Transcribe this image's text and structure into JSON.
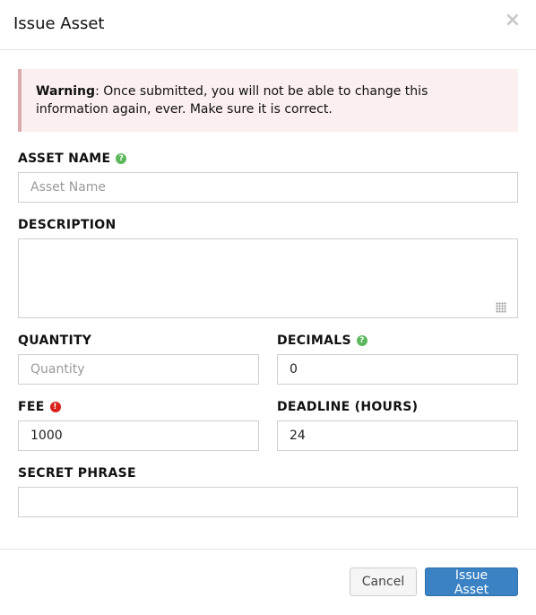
{
  "dialog": {
    "title": "Issue Asset",
    "close_glyph": "×"
  },
  "warning": {
    "strong": "Warning",
    "text": ": Once submitted, you will not be able to change this information again, ever. Make sure it is correct."
  },
  "fields": {
    "asset_name": {
      "label": "ASSET NAME",
      "placeholder": "Asset Name",
      "value": "",
      "icon": "question-circle-icon"
    },
    "description": {
      "label": "DESCRIPTION",
      "value": ""
    },
    "quantity": {
      "label": "QUANTITY",
      "placeholder": "Quantity",
      "value": ""
    },
    "decimals": {
      "label": "DECIMALS",
      "value": "0",
      "icon": "question-circle-icon"
    },
    "fee": {
      "label": "FEE",
      "value": "1000",
      "icon": "exclamation-circle-icon"
    },
    "deadline": {
      "label": "DEADLINE (HOURS)",
      "value": "24"
    },
    "secret_phrase": {
      "label": "SECRET PHRASE",
      "value": ""
    }
  },
  "buttons": {
    "cancel": "Cancel",
    "submit": "Issue Asset"
  },
  "colors": {
    "primary": "#3a82c4",
    "help": "#5cb85c",
    "alert": "#d9201b",
    "warning_bg": "#fbefef"
  }
}
